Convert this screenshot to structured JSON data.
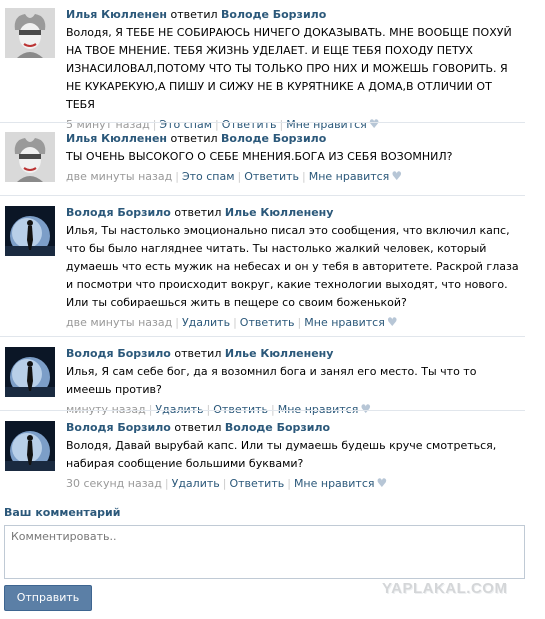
{
  "comments": [
    {
      "author": "Илья Кюлленен",
      "verb": "ответил",
      "target": "Володе Борзило",
      "text": "Володя, Я ТЕБЕ НЕ СОБИРАЮСЬ НИЧЕГО ДОКАЗЫВАТЬ. МНЕ ВООБЩЕ ПОХУЙ НА ТВОЕ МНЕНИЕ. ТЕБЯ ЖИЗНЬ УДЕЛАЕТ. И ЕЩЕ ТЕБЯ ПОХОДУ ПЕТУХ ИЗНАСИЛОВАЛ,ПОТОМУ ЧТО ТЫ ТОЛЬКО ПРО НИХ И МОЖЕШЬ ГОВОРИТЬ. Я НЕ КУКАРЕКУЮ,А ПИШУ И СИЖУ НЕ В КУРЯТНИКЕ А ДОМА,В ОТЛИЧИИ ОТ ТЕБЯ",
      "time": "5 минут назад",
      "action": "Это спам",
      "reply": "Ответить",
      "like": "Мне нравится",
      "avatar": "harlequin"
    },
    {
      "author": "Илья Кюлленен",
      "verb": "ответил",
      "target": "Володе Борзило",
      "text": "ТЫ ОЧЕНЬ ВЫСОКОГО О СЕБЕ МНЕНИЯ.БОГА ИЗ СЕБЯ ВОЗОМНИЛ?",
      "time": "две минуты назад",
      "action": "Это спам",
      "reply": "Ответить",
      "like": "Мне нравится",
      "avatar": "harlequin"
    },
    {
      "author": "Володя Борзило",
      "verb": "ответил",
      "target": "Илье Кюлленену",
      "text": "Илья, Ты настолько эмоционально писал это сообщения, что включил капс, что бы было нагляднее читать. Ты настолько жалкий человек, который думаешь что есть мужик на небесах и он у тебя в авторитете. Раскрой глаза и посмотри что происходит вокруг, какие технологии выходят, что нового. Или ты собираешься жить в пещере со своим боженькой?",
      "time": "две минуты назад",
      "action": "Удалить",
      "reply": "Ответить",
      "like": "Мне нравится",
      "avatar": "planet"
    },
    {
      "author": "Володя Борзило",
      "verb": "ответил",
      "target": "Илье Кюлленену",
      "text": "Илья, Я сам себе бог, да я возомнил бога и занял его место. Ты что то имеешь против?",
      "time": "минуту назад",
      "action": "Удалить",
      "reply": "Ответить",
      "like": "Мне нравится",
      "avatar": "planet"
    },
    {
      "author": "Володя Борзило",
      "verb": "ответил",
      "target": "Володе Борзило",
      "text": "Володя, Давай вырубай капс. Или ты думаешь будешь круче смотреться, набирая сообщение большими буквами?",
      "time": "30 секунд назад",
      "action": "Удалить",
      "reply": "Ответить",
      "like": "Мне нравится",
      "avatar": "planet"
    }
  ],
  "form": {
    "label": "Ваш комментарий",
    "placeholder": "Комментировать..",
    "submit": "Отправить"
  },
  "watermark": "YAPLAKAL.COM",
  "colors": {
    "link": "#2b587a",
    "meta": "#999999",
    "button": "#5b7fa6"
  }
}
